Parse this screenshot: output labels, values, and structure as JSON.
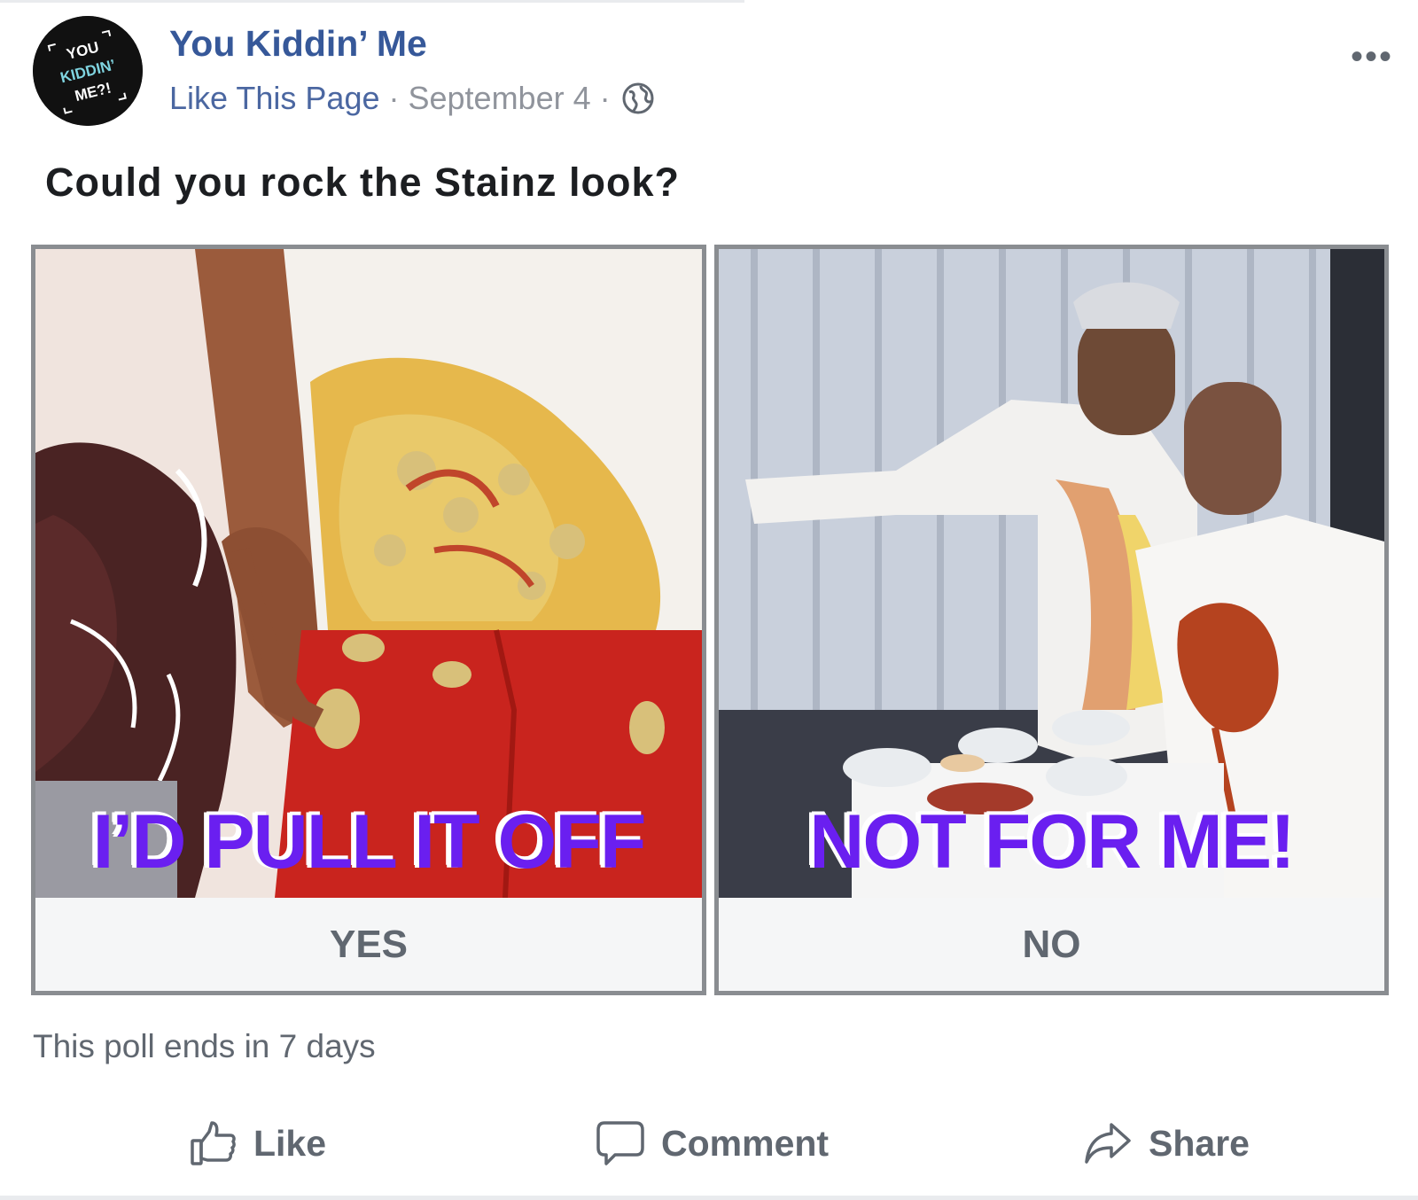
{
  "page": {
    "name": "You Kiddin’ Me",
    "avatar_text": [
      "YOU",
      "KIDDIN’",
      "ME?!"
    ],
    "like_link": "Like This Page",
    "separator": "·",
    "date": "September 4",
    "privacy_icon": "globe-icon"
  },
  "menu": {
    "more_label": "•••"
  },
  "post": {
    "question": "Could you rock the Stainz look?"
  },
  "poll": {
    "options": [
      {
        "overlay": "I’D PULL IT OFF",
        "label": "YES"
      },
      {
        "overlay": "NOT FOR ME!",
        "label": "NO"
      }
    ],
    "footer": "This poll ends in 7 days"
  },
  "actions": {
    "like": "Like",
    "comment": "Comment",
    "share": "Share"
  },
  "colors": {
    "brand_link": "#365899",
    "overlay_text": "#6a1ff0",
    "muted": "#606770"
  }
}
